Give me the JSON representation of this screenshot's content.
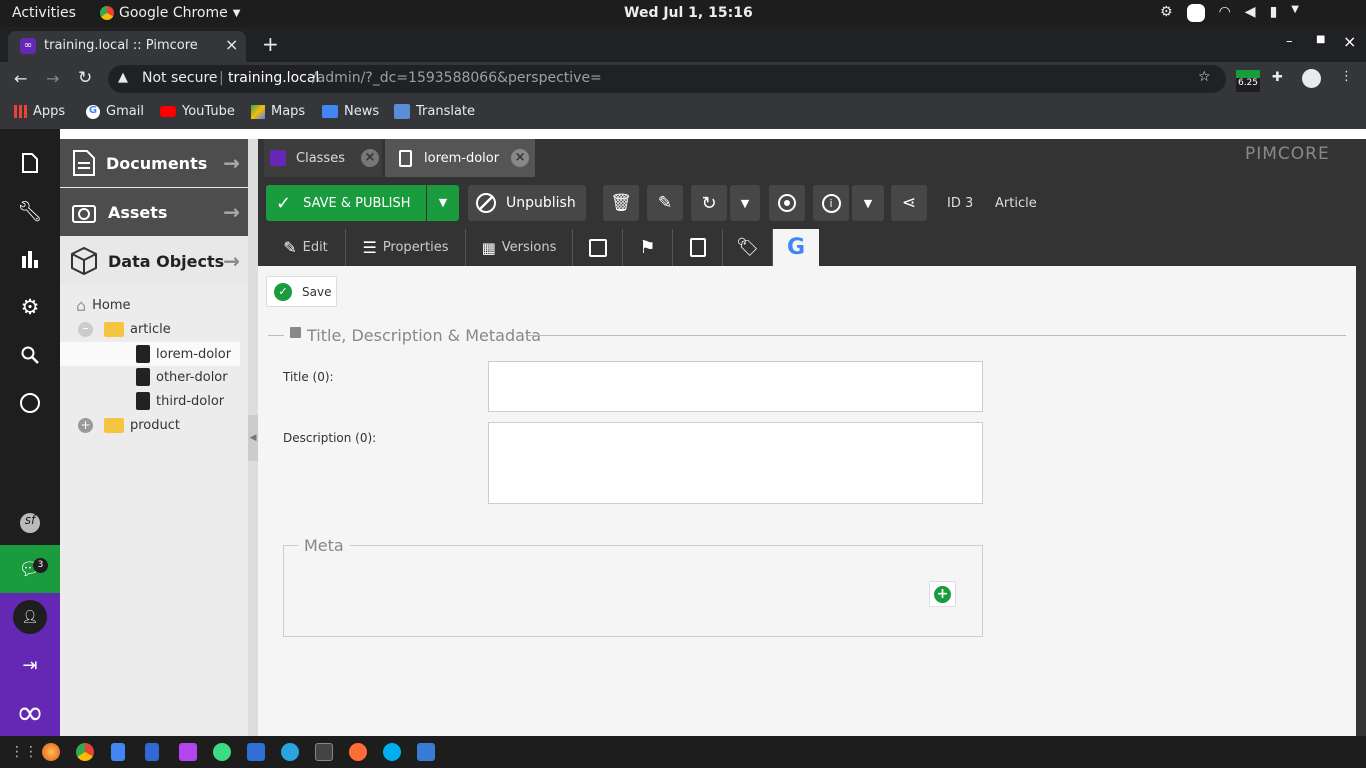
{
  "system": {
    "activities": "Activities",
    "app": "Google Chrome",
    "clock": "Wed Jul  1, 15:16"
  },
  "browser": {
    "tab_title": "training.local :: Pimcore",
    "security": "Not secure",
    "url_host": "training.local",
    "url_path": "/admin/?_dc=1593588066&perspective=",
    "ext_badge": "6.25"
  },
  "bookmarks": [
    "Apps",
    "Gmail",
    "YouTube",
    "Maps",
    "News",
    "Translate"
  ],
  "sidebar": {
    "chat_badge": "3"
  },
  "tree": {
    "sections": [
      "Documents",
      "Assets",
      "Data Objects"
    ],
    "nodes": [
      "Home",
      "article",
      "lorem-dolor",
      "other-dolor",
      "third-dolor",
      "product"
    ]
  },
  "tabs": {
    "classes": "Classes",
    "doc": "lorem-dolor"
  },
  "brand": "PIMCORE",
  "toolbar": {
    "save_publish": "SAVE & PUBLISH",
    "unpublish": "Unpublish",
    "id": "ID 3",
    "type": "Article"
  },
  "subtabs": {
    "edit": "Edit",
    "properties": "Properties",
    "versions": "Versions"
  },
  "form": {
    "save": "Save",
    "section": "Title, Description & Metadata",
    "title_label": "Title (0):",
    "desc_label": "Description (0):",
    "meta": "Meta"
  },
  "colors": {
    "accent": "#1a9c3e",
    "purple": "#6428b4",
    "pimcore_bg": "#333333"
  }
}
